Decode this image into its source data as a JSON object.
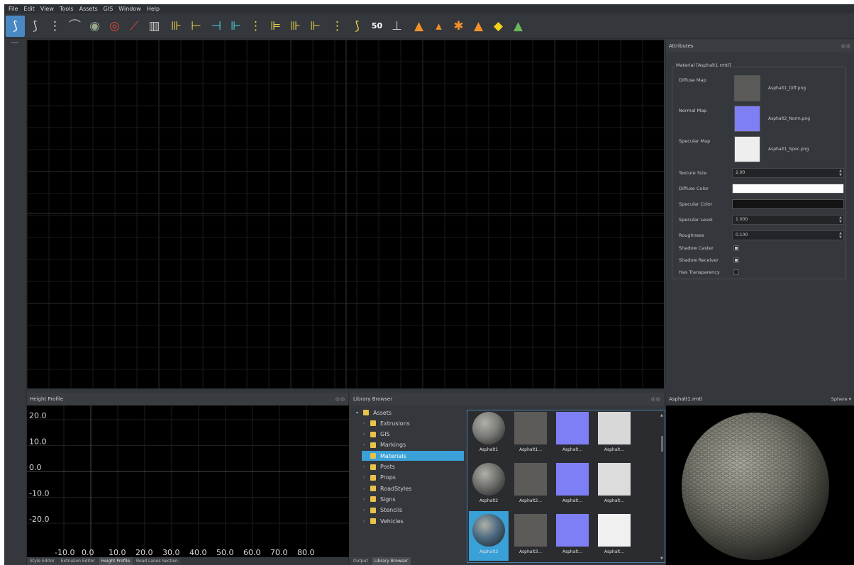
{
  "menu": [
    "File",
    "Edit",
    "View",
    "Tools",
    "Assets",
    "GIS",
    "Window",
    "Help"
  ],
  "toolbar": {
    "tools": [
      {
        "icon": "road-tool-icon",
        "glyph": "⟆",
        "color": "#ffffff",
        "active": true
      },
      {
        "icon": "road-curve-icon",
        "glyph": "⟆",
        "color": "#c8c8c8"
      },
      {
        "icon": "lane-divider-icon",
        "glyph": "⋮",
        "color": "#e0e0e0"
      },
      {
        "icon": "bridge-icon",
        "glyph": "⌒",
        "color": "#b0b0b0"
      },
      {
        "icon": "roundabout-icon",
        "glyph": "◉",
        "color": "#9aa890"
      },
      {
        "icon": "junction-icon",
        "glyph": "◎",
        "color": "#e04a3a"
      },
      {
        "icon": "ramp-icon",
        "glyph": "⟋",
        "color": "#e04a3a"
      },
      {
        "icon": "building-icon",
        "glyph": "▥",
        "color": "#c8c8c8",
        "sep": true
      },
      {
        "icon": "lane-add-icon",
        "glyph": "⊪",
        "color": "#e8d24a"
      },
      {
        "icon": "lane-width-icon",
        "glyph": "⊢",
        "color": "#e8d24a"
      },
      {
        "icon": "lane-split-icon",
        "glyph": "⊣",
        "color": "#4ad2e8"
      },
      {
        "icon": "lane-merge-icon",
        "glyph": "⊩",
        "color": "#4ad2e8"
      },
      {
        "icon": "lane-marking-icon",
        "glyph": "⋮",
        "color": "#e8d24a"
      },
      {
        "icon": "lane-marking-2-icon",
        "glyph": "⊫",
        "color": "#e8d24a"
      },
      {
        "icon": "lane-marking-3-icon",
        "glyph": "⊪",
        "color": "#e8d24a"
      },
      {
        "icon": "lane-marking-4-icon",
        "glyph": "⊩",
        "color": "#e8d24a",
        "sep": true
      },
      {
        "icon": "crossing-icon",
        "glyph": "⋮",
        "color": "#e8d24a"
      },
      {
        "icon": "path-icon",
        "glyph": "⟆",
        "color": "#e8d24a"
      },
      {
        "icon": "speed-sign-icon",
        "glyph": "50",
        "color": "#ffffff"
      },
      {
        "icon": "terrain-flat-icon",
        "glyph": "⊥",
        "color": "#c8c8c8",
        "sep": true
      },
      {
        "icon": "cone-icon",
        "glyph": "▲",
        "color": "#f0902a"
      },
      {
        "icon": "cones-icon",
        "glyph": "▴",
        "color": "#f0902a"
      },
      {
        "icon": "barrier-icon",
        "glyph": "✱",
        "color": "#f0902a"
      },
      {
        "icon": "fence-icon",
        "glyph": "▲",
        "color": "#f0902a"
      },
      {
        "icon": "road-sign-icon",
        "glyph": "◆",
        "color": "#f0d21a"
      },
      {
        "icon": "terrain-icon",
        "glyph": "▲",
        "color": "#6ab85a"
      }
    ]
  },
  "attributes": {
    "title": "Attributes",
    "group_title": "Material [Asphalt1.rmtl]",
    "maps": [
      {
        "label": "Diffuse Map",
        "file": "Asphalt1_Diff.png",
        "color": "#5a5a58"
      },
      {
        "label": "Normal Map",
        "file": "Asphalt2_Norm.png",
        "color": "#7f7ff5"
      },
      {
        "label": "Specular Map",
        "file": "Asphalt1_Spec.png",
        "color": "#eeeeee"
      }
    ],
    "fields": [
      {
        "label": "Texture Size",
        "value": "2.00",
        "spin": true
      },
      {
        "label": "Diffuse Color",
        "value": "",
        "color": "#ffffff"
      },
      {
        "label": "Specular Color",
        "value": "",
        "color": "#141414"
      },
      {
        "label": "Specular Level",
        "value": "1.000",
        "spin": true
      },
      {
        "label": "Roughness",
        "value": "0.100",
        "spin": true
      }
    ],
    "checks": [
      {
        "label": "Shadow Caster",
        "checked": true
      },
      {
        "label": "Shadow Receiver",
        "checked": true
      },
      {
        "label": "Has Transparency",
        "checked": false
      }
    ]
  },
  "height_profile": {
    "title": "Height Profile",
    "tabs": [
      "Style Editor",
      "Extrusion Editor",
      "Height Profile",
      "Road Lanes Section"
    ],
    "active_tab": 2
  },
  "chart_data": {
    "type": "line",
    "title": "",
    "xlabel": "",
    "ylabel": "",
    "x_ticks": [
      "-10.0",
      "0.0",
      "10.0",
      "20.0",
      "30.0",
      "40.0",
      "50.0",
      "60.0",
      "70.0",
      "80.0"
    ],
    "y_ticks": [
      "20.0",
      "10.0",
      "0.0",
      "-10.0",
      "-20.0"
    ],
    "xlim": [
      -10,
      80
    ],
    "ylim": [
      -20,
      20
    ],
    "grid": true,
    "series": []
  },
  "library": {
    "title": "Library Browser",
    "tree": [
      {
        "label": "Assets",
        "level": 0,
        "expanded": true
      },
      {
        "label": "Extrusions",
        "level": 1
      },
      {
        "label": "GIS",
        "level": 1
      },
      {
        "label": "Markings",
        "level": 1
      },
      {
        "label": "Materials",
        "level": 1,
        "selected": true
      },
      {
        "label": "Posts",
        "level": 1
      },
      {
        "label": "Props",
        "level": 1
      },
      {
        "label": "RoadStyles",
        "level": 1
      },
      {
        "label": "Signs",
        "level": 1
      },
      {
        "label": "Stencils",
        "level": 1
      },
      {
        "label": "Vehicles",
        "level": 1
      }
    ],
    "tiles": [
      {
        "label": "Asphalt1",
        "kind": "sphere",
        "color": "#7a7c78"
      },
      {
        "label": "Asphalt1...",
        "kind": "square",
        "color": "#5c5b58"
      },
      {
        "label": "Asphalt...",
        "kind": "square",
        "color": "#7f7ff5"
      },
      {
        "label": "Asphalt...",
        "kind": "square",
        "color": "#d8d8d8"
      },
      {
        "label": "Asphalt2",
        "kind": "sphere",
        "color": "#6e706c"
      },
      {
        "label": "Asphalt2...",
        "kind": "square",
        "color": "#5c5b58"
      },
      {
        "label": "Asphalt...",
        "kind": "square",
        "color": "#7f7ff5"
      },
      {
        "label": "Asphalt...",
        "kind": "square",
        "color": "#dcdcdc"
      },
      {
        "label": "Asphalt3",
        "kind": "sphere",
        "color": "#4a6a80",
        "selected": true
      },
      {
        "label": "Asphalt3...",
        "kind": "square",
        "color": "#5c5b58"
      },
      {
        "label": "Asphalt...",
        "kind": "square",
        "color": "#7f7ff5"
      },
      {
        "label": "Asphalt...",
        "kind": "square",
        "color": "#f0f0f0"
      }
    ],
    "tabs": [
      "Output",
      "Library Browser"
    ],
    "active_tab": 1
  },
  "preview": {
    "title": "Asphalt1.rmtl",
    "mode": "Sphere ▾"
  }
}
